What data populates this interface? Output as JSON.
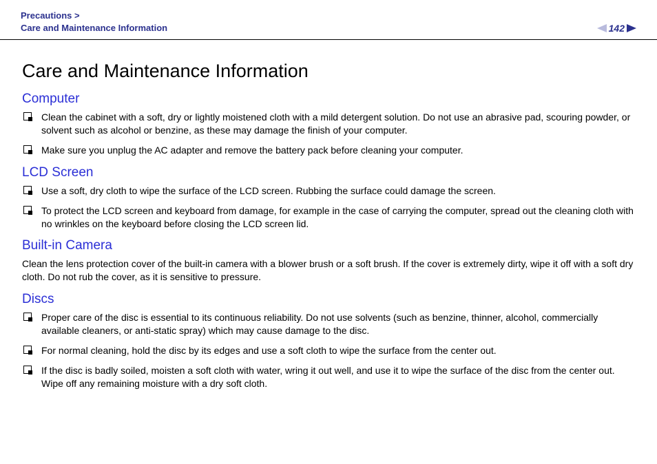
{
  "header": {
    "breadcrumb_parent": "Precautions >",
    "breadcrumb_current": "Care and Maintenance Information",
    "page_number": "142"
  },
  "title": "Care and Maintenance Information",
  "sections": [
    {
      "heading": "Computer",
      "items": [
        "Clean the cabinet with a soft, dry or lightly moistened cloth with a mild detergent solution. Do not use an abrasive pad, scouring powder, or solvent such as alcohol or benzine, as these may damage the finish of your computer.",
        "Make sure you unplug the AC adapter and remove the battery pack before cleaning your computer."
      ]
    },
    {
      "heading": "LCD Screen",
      "items": [
        "Use a soft, dry cloth to wipe the surface of the LCD screen. Rubbing the surface could damage the screen.",
        "To protect the LCD screen and keyboard from damage, for example in the case of carrying the computer, spread out the cleaning cloth with no wrinkles on the keyboard before closing the LCD screen lid."
      ]
    },
    {
      "heading": "Built-in Camera",
      "paragraph": "Clean the lens protection cover of the built-in camera with a blower brush or a soft brush. If the cover is extremely dirty, wipe it off with a soft dry cloth. Do not rub the cover, as it is sensitive to pressure."
    },
    {
      "heading": "Discs",
      "items": [
        "Proper care of the disc is essential to its continuous reliability. Do not use solvents (such as benzine, thinner, alcohol, commercially available cleaners, or anti-static spray) which may cause damage to the disc.",
        "For normal cleaning, hold the disc by its edges and use a soft cloth to wipe the surface from the center out.",
        "If the disc is badly soiled, moisten a soft cloth with water, wring it out well, and use it to wipe the surface of the disc from the center out. Wipe off any remaining moisture with a dry soft cloth."
      ]
    }
  ]
}
